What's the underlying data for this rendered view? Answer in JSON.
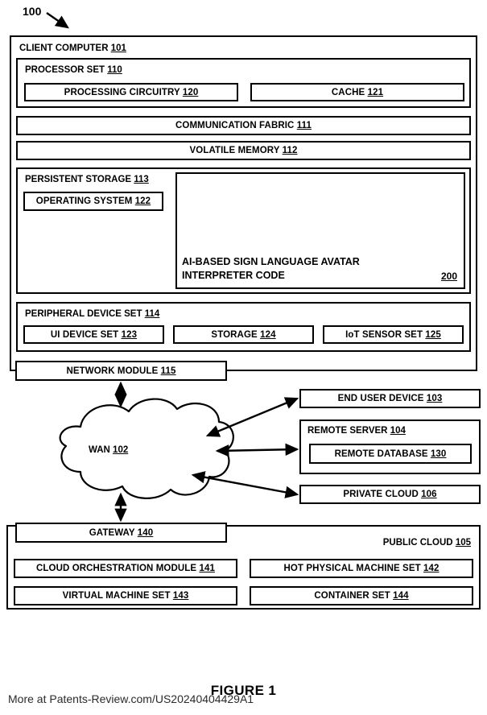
{
  "figure": {
    "ref_number": "100",
    "caption": "FIGURE 1",
    "watermark": "More at Patents-Review.com/US20240404429A1"
  },
  "client_computer": {
    "label": "CLIENT COMPUTER",
    "ref": "101",
    "processor_set": {
      "label": "PROCESSOR SET",
      "ref": "110",
      "children": [
        {
          "label": "PROCESSING CIRCUITRY",
          "ref": "120"
        },
        {
          "label": "CACHE",
          "ref": "121"
        }
      ]
    },
    "communication_fabric": {
      "label": "COMMUNICATION FABRIC",
      "ref": "111"
    },
    "volatile_memory": {
      "label": "VOLATILE MEMORY",
      "ref": "112"
    },
    "persistent_storage": {
      "label": "PERSISTENT STORAGE",
      "ref": "113",
      "operating_system": {
        "label": "OPERATING SYSTEM",
        "ref": "122"
      },
      "code_module": {
        "label": "AI-BASED SIGN LANGUAGE AVATAR\nINTERPRETER CODE",
        "ref": "200"
      }
    },
    "peripheral_device_set": {
      "label": "PERIPHERAL DEVICE SET",
      "ref": "114",
      "children": [
        {
          "label": "UI DEVICE SET",
          "ref": "123"
        },
        {
          "label": "STORAGE",
          "ref": "124"
        },
        {
          "label": "IoT SENSOR SET",
          "ref": "125"
        }
      ]
    },
    "network_module": {
      "label": "NETWORK MODULE",
      "ref": "115"
    }
  },
  "wan": {
    "label": "WAN",
    "ref": "102"
  },
  "right_nodes": {
    "end_user_device": {
      "label": "END USER DEVICE",
      "ref": "103"
    },
    "remote_server": {
      "label": "REMOTE SERVER",
      "ref": "104",
      "remote_database": {
        "label": "REMOTE DATABASE",
        "ref": "130"
      }
    },
    "private_cloud": {
      "label": "PRIVATE CLOUD",
      "ref": "106"
    }
  },
  "public_cloud": {
    "label": "PUBLIC CLOUD",
    "ref": "105",
    "gateway": {
      "label": "GATEWAY",
      "ref": "140"
    },
    "children": [
      {
        "label": "CLOUD ORCHESTRATION MODULE",
        "ref": "141"
      },
      {
        "label": "HOT PHYSICAL MACHINE SET",
        "ref": "142"
      },
      {
        "label": "VIRTUAL MACHINE SET",
        "ref": "143"
      },
      {
        "label": "CONTAINER SET",
        "ref": "144"
      }
    ]
  },
  "colors": {
    "ink": "#000000",
    "paper": "#ffffff"
  }
}
